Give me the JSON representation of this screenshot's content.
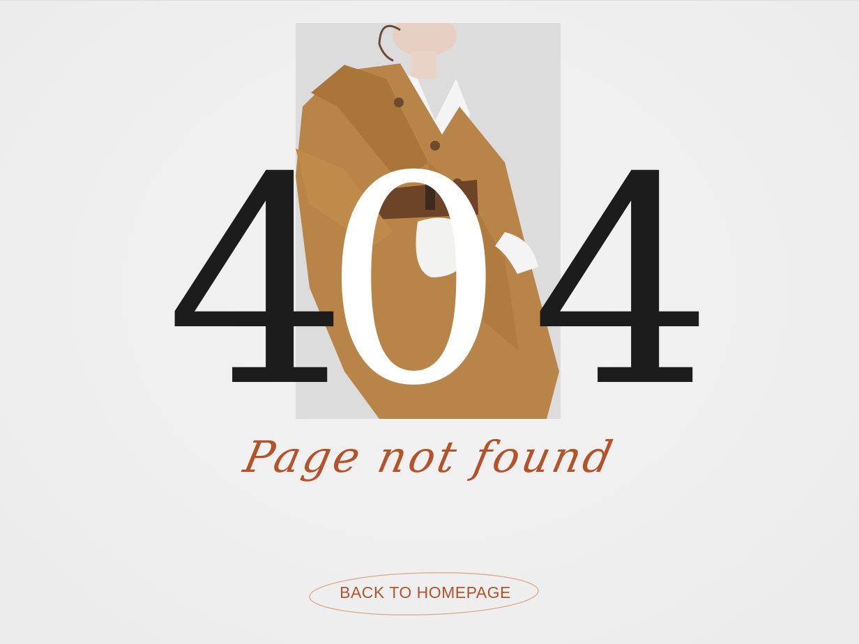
{
  "hero": {
    "digits": {
      "left": "4",
      "middle": "0",
      "right": "4"
    },
    "subtitle": "Page not found"
  },
  "actions": {
    "back_label": "BACK TO HOMEPAGE"
  },
  "colors": {
    "accent": "#b4532a",
    "ink": "#1c1c1c",
    "background": "#efefef",
    "coat": "#b98448"
  }
}
